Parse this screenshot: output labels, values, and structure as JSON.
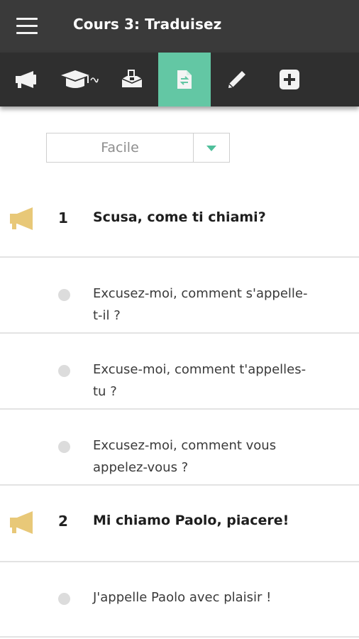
{
  "header": {
    "title": "Cours 3: Traduisez"
  },
  "toolbar": {
    "tools": [
      {
        "icon": "megaphone-icon"
      },
      {
        "icon": "graduation-cap-icon"
      },
      {
        "icon": "inbox-upload-icon"
      },
      {
        "icon": "translate-document-icon",
        "active": true
      },
      {
        "icon": "pencil-icon"
      },
      {
        "icon": "plus-square-icon"
      }
    ]
  },
  "level_select": {
    "value": "Facile"
  },
  "questions": [
    {
      "number": "1",
      "text": "Scusa, come ti chiami?",
      "answers": [
        {
          "line1": "Excusez-moi, comment s'appelle-",
          "line2": "t-il ?"
        },
        {
          "line1": "Excuse-moi, comment t'appelles-",
          "line2": "tu ?"
        },
        {
          "line1": "Excusez-moi, comment vous",
          "line2": "appelez-vous ?"
        }
      ]
    },
    {
      "number": "2",
      "text": "Mi chiamo Paolo, piacere!",
      "answers": [
        {
          "line1": "J'appelle Paolo avec plaisir !",
          "line2": ""
        }
      ]
    }
  ],
  "colors": {
    "header_bg": "#3a3a3a",
    "toolbar_bg": "#2f2f2f",
    "accent": "#63c7a4",
    "speaker": "#e8c878",
    "radio": "#dcdcdc"
  }
}
